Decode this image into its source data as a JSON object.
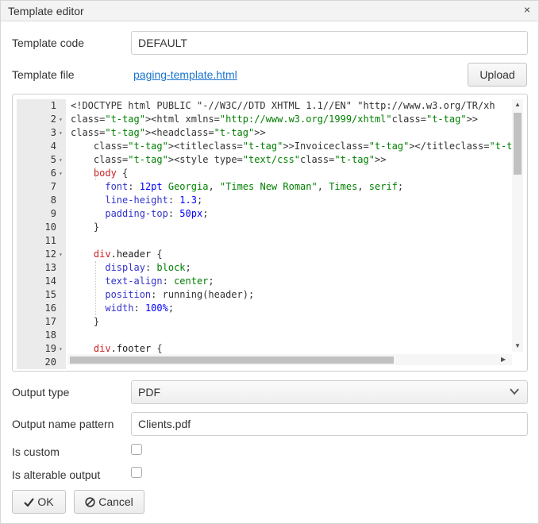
{
  "dialog": {
    "title": "Template editor",
    "close_glyph": "×"
  },
  "form": {
    "template_code": {
      "label": "Template code",
      "value": "DEFAULT"
    },
    "template_file": {
      "label": "Template file",
      "link": "paging-template.html",
      "upload_label": "Upload"
    },
    "output_type": {
      "label": "Output type",
      "selected": "PDF"
    },
    "output_name_pattern": {
      "label": "Output name pattern",
      "value": "Clients.pdf"
    },
    "is_custom": {
      "label": "Is custom",
      "checked": false
    },
    "is_alterable_output": {
      "label": "Is alterable output",
      "checked": false
    }
  },
  "editor": {
    "lines": [
      {
        "n": "1",
        "fold": false,
        "text": "<!DOCTYPE html PUBLIC \"-//W3C//DTD XHTML 1.1//EN\" \"http://www.w3.org/TR/xh"
      },
      {
        "n": "2",
        "fold": true,
        "text": "<html xmlns=\"http://www.w3.org/1999/xhtml\">"
      },
      {
        "n": "3",
        "fold": true,
        "text": "<head>"
      },
      {
        "n": "4",
        "fold": false,
        "text": "    <title>Invoice</title>"
      },
      {
        "n": "5",
        "fold": true,
        "text": "    <style type=\"text/css\">"
      },
      {
        "n": "6",
        "fold": true,
        "text": "    body {"
      },
      {
        "n": "7",
        "fold": false,
        "text": "      font: 12pt Georgia, \"Times New Roman\", Times, serif;"
      },
      {
        "n": "8",
        "fold": false,
        "text": "      line-height: 1.3;"
      },
      {
        "n": "9",
        "fold": false,
        "text": "      padding-top: 50px;"
      },
      {
        "n": "10",
        "fold": false,
        "text": "    }"
      },
      {
        "n": "11",
        "fold": false,
        "text": ""
      },
      {
        "n": "12",
        "fold": true,
        "text": "    div.header {"
      },
      {
        "n": "13",
        "fold": false,
        "text": "      display: block;"
      },
      {
        "n": "14",
        "fold": false,
        "text": "      text-align: center;"
      },
      {
        "n": "15",
        "fold": false,
        "text": "      position: running(header);"
      },
      {
        "n": "16",
        "fold": false,
        "text": "      width: 100%;"
      },
      {
        "n": "17",
        "fold": false,
        "text": "    }"
      },
      {
        "n": "18",
        "fold": false,
        "text": ""
      },
      {
        "n": "19",
        "fold": true,
        "text": "    div.footer {"
      },
      {
        "n": "20",
        "fold": false,
        "text": ""
      }
    ]
  },
  "buttons": {
    "ok": "OK",
    "cancel": "Cancel"
  },
  "icons": {
    "fold": "fold-arrow-icon",
    "chevron": "chevron-down-icon",
    "check": "check-icon",
    "cancel": "cancel-circle-icon"
  },
  "colors": {
    "link": "#1a75cf",
    "tag": "#0000cc",
    "string": "#007f00",
    "selector": "#cc2222",
    "property": "#3333cc",
    "number": "#0000ff"
  }
}
